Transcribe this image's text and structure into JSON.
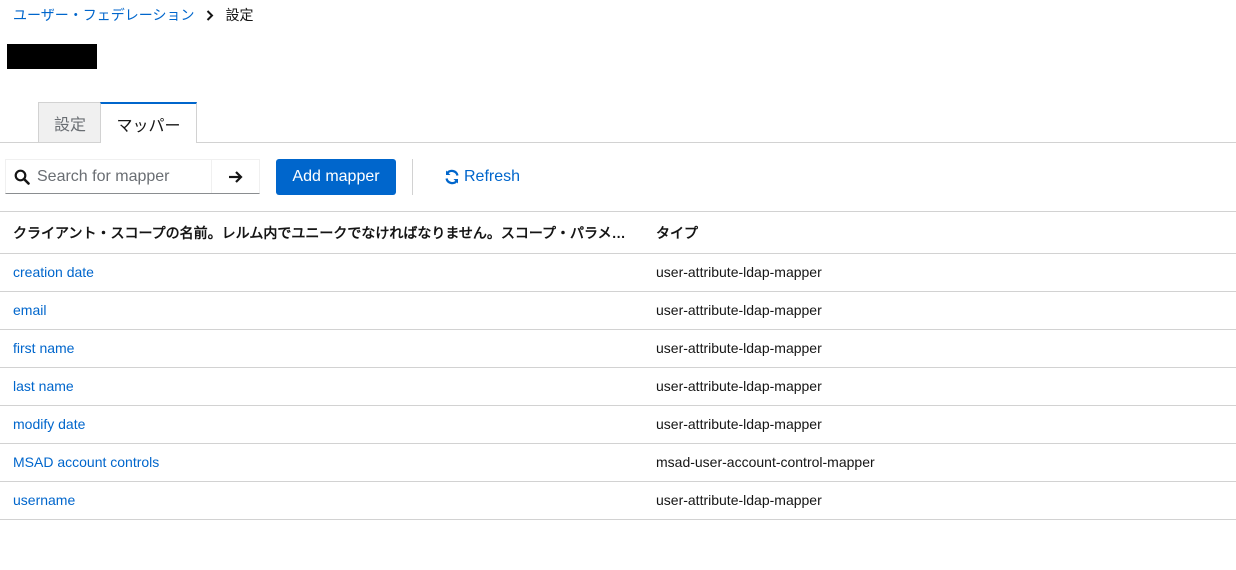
{
  "breadcrumb": {
    "parent": "ユーザー・フェデレーション",
    "current": "設定",
    "separator_icon": "chevron-right-icon"
  },
  "title": {
    "redacted_color": "#000000"
  },
  "tabs": [
    {
      "label": "設定",
      "active": false
    },
    {
      "label": "マッパー",
      "active": true
    }
  ],
  "toolbar": {
    "search": {
      "placeholder": "Search for mapper",
      "value": "",
      "icon": "search-icon",
      "submit_icon": "arrow-right-icon"
    },
    "add_label": "Add mapper",
    "refresh_label": "Refresh",
    "refresh_icon": "sync-icon"
  },
  "table": {
    "columns": [
      "クライアント・スコープの名前。レルム内でユニークでなければなりません。スコープ・パラメーターの値として使用されるため、この名前には空白文字を含めないでください",
      "タイプ"
    ],
    "rows": [
      {
        "name": "creation date",
        "type": "user-attribute-ldap-mapper"
      },
      {
        "name": "email",
        "type": "user-attribute-ldap-mapper"
      },
      {
        "name": "first name",
        "type": "user-attribute-ldap-mapper"
      },
      {
        "name": "last name",
        "type": "user-attribute-ldap-mapper"
      },
      {
        "name": "modify date",
        "type": "user-attribute-ldap-mapper"
      },
      {
        "name": "MSAD account controls",
        "type": "msad-user-account-control-mapper"
      },
      {
        "name": "username",
        "type": "user-attribute-ldap-mapper"
      }
    ]
  },
  "colors": {
    "accent": "#0066cc",
    "border": "#d2d2d2",
    "text": "#151515"
  }
}
